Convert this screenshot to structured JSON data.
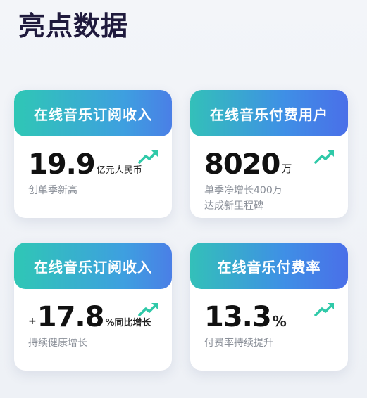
{
  "page": {
    "title": "亮点数据"
  },
  "cards": [
    {
      "header": "在线音乐订阅收入",
      "prefix": "",
      "value": "19.9",
      "unit": "亿元人民币",
      "desc": [
        "创单季新高"
      ]
    },
    {
      "header": "在线音乐付费用户",
      "prefix": "",
      "value": "8020",
      "unit": "万",
      "desc": [
        "单季净增长400万",
        "达成新里程碑"
      ]
    },
    {
      "header": "在线音乐订阅收入",
      "prefix": "+",
      "value": "17.8",
      "unit": "%同比增长",
      "desc": [
        "持续健康增长"
      ]
    },
    {
      "header": "在线音乐付费率",
      "prefix": "",
      "value": "13.3",
      "unit": "%",
      "desc": [
        "付费率持续提升"
      ]
    }
  ],
  "icons": {
    "trend": "trend-up-arrow-icon"
  },
  "colors": {
    "accent_teal": "#2fc7b5",
    "accent_blue": "#4a7fe6",
    "trend_icon": "#2fc9a8",
    "title": "#1f1a3d"
  }
}
